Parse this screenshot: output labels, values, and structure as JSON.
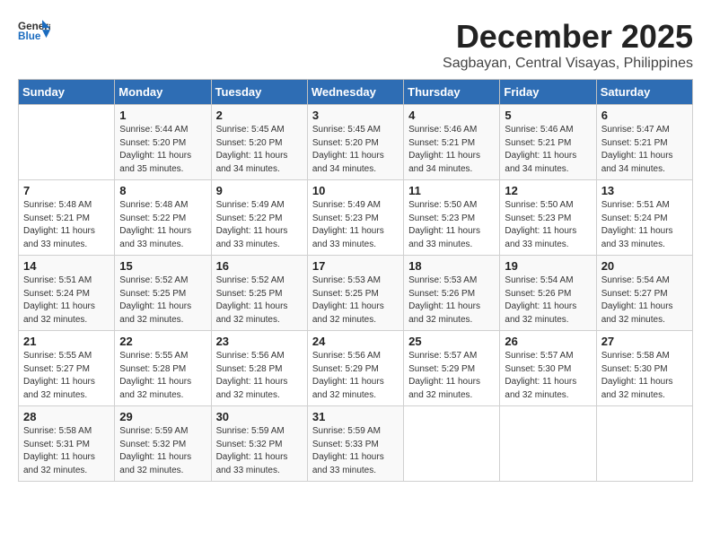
{
  "header": {
    "logo_general": "General",
    "logo_blue": "Blue",
    "month": "December 2025",
    "location": "Sagbayan, Central Visayas, Philippines"
  },
  "weekdays": [
    "Sunday",
    "Monday",
    "Tuesday",
    "Wednesday",
    "Thursday",
    "Friday",
    "Saturday"
  ],
  "weeks": [
    [
      null,
      {
        "day": "1",
        "sunrise": "5:44 AM",
        "sunset": "5:20 PM",
        "daylight": "11 hours and 35 minutes."
      },
      {
        "day": "2",
        "sunrise": "5:45 AM",
        "sunset": "5:20 PM",
        "daylight": "11 hours and 34 minutes."
      },
      {
        "day": "3",
        "sunrise": "5:45 AM",
        "sunset": "5:20 PM",
        "daylight": "11 hours and 34 minutes."
      },
      {
        "day": "4",
        "sunrise": "5:46 AM",
        "sunset": "5:21 PM",
        "daylight": "11 hours and 34 minutes."
      },
      {
        "day": "5",
        "sunrise": "5:46 AM",
        "sunset": "5:21 PM",
        "daylight": "11 hours and 34 minutes."
      },
      {
        "day": "6",
        "sunrise": "5:47 AM",
        "sunset": "5:21 PM",
        "daylight": "11 hours and 34 minutes."
      }
    ],
    [
      {
        "day": "7",
        "sunrise": "5:48 AM",
        "sunset": "5:21 PM",
        "daylight": "11 hours and 33 minutes."
      },
      {
        "day": "8",
        "sunrise": "5:48 AM",
        "sunset": "5:22 PM",
        "daylight": "11 hours and 33 minutes."
      },
      {
        "day": "9",
        "sunrise": "5:49 AM",
        "sunset": "5:22 PM",
        "daylight": "11 hours and 33 minutes."
      },
      {
        "day": "10",
        "sunrise": "5:49 AM",
        "sunset": "5:23 PM",
        "daylight": "11 hours and 33 minutes."
      },
      {
        "day": "11",
        "sunrise": "5:50 AM",
        "sunset": "5:23 PM",
        "daylight": "11 hours and 33 minutes."
      },
      {
        "day": "12",
        "sunrise": "5:50 AM",
        "sunset": "5:23 PM",
        "daylight": "11 hours and 33 minutes."
      },
      {
        "day": "13",
        "sunrise": "5:51 AM",
        "sunset": "5:24 PM",
        "daylight": "11 hours and 33 minutes."
      }
    ],
    [
      {
        "day": "14",
        "sunrise": "5:51 AM",
        "sunset": "5:24 PM",
        "daylight": "11 hours and 32 minutes."
      },
      {
        "day": "15",
        "sunrise": "5:52 AM",
        "sunset": "5:25 PM",
        "daylight": "11 hours and 32 minutes."
      },
      {
        "day": "16",
        "sunrise": "5:52 AM",
        "sunset": "5:25 PM",
        "daylight": "11 hours and 32 minutes."
      },
      {
        "day": "17",
        "sunrise": "5:53 AM",
        "sunset": "5:25 PM",
        "daylight": "11 hours and 32 minutes."
      },
      {
        "day": "18",
        "sunrise": "5:53 AM",
        "sunset": "5:26 PM",
        "daylight": "11 hours and 32 minutes."
      },
      {
        "day": "19",
        "sunrise": "5:54 AM",
        "sunset": "5:26 PM",
        "daylight": "11 hours and 32 minutes."
      },
      {
        "day": "20",
        "sunrise": "5:54 AM",
        "sunset": "5:27 PM",
        "daylight": "11 hours and 32 minutes."
      }
    ],
    [
      {
        "day": "21",
        "sunrise": "5:55 AM",
        "sunset": "5:27 PM",
        "daylight": "11 hours and 32 minutes."
      },
      {
        "day": "22",
        "sunrise": "5:55 AM",
        "sunset": "5:28 PM",
        "daylight": "11 hours and 32 minutes."
      },
      {
        "day": "23",
        "sunrise": "5:56 AM",
        "sunset": "5:28 PM",
        "daylight": "11 hours and 32 minutes."
      },
      {
        "day": "24",
        "sunrise": "5:56 AM",
        "sunset": "5:29 PM",
        "daylight": "11 hours and 32 minutes."
      },
      {
        "day": "25",
        "sunrise": "5:57 AM",
        "sunset": "5:29 PM",
        "daylight": "11 hours and 32 minutes."
      },
      {
        "day": "26",
        "sunrise": "5:57 AM",
        "sunset": "5:30 PM",
        "daylight": "11 hours and 32 minutes."
      },
      {
        "day": "27",
        "sunrise": "5:58 AM",
        "sunset": "5:30 PM",
        "daylight": "11 hours and 32 minutes."
      }
    ],
    [
      {
        "day": "28",
        "sunrise": "5:58 AM",
        "sunset": "5:31 PM",
        "daylight": "11 hours and 32 minutes."
      },
      {
        "day": "29",
        "sunrise": "5:59 AM",
        "sunset": "5:32 PM",
        "daylight": "11 hours and 32 minutes."
      },
      {
        "day": "30",
        "sunrise": "5:59 AM",
        "sunset": "5:32 PM",
        "daylight": "11 hours and 33 minutes."
      },
      {
        "day": "31",
        "sunrise": "5:59 AM",
        "sunset": "5:33 PM",
        "daylight": "11 hours and 33 minutes."
      },
      null,
      null,
      null
    ]
  ]
}
